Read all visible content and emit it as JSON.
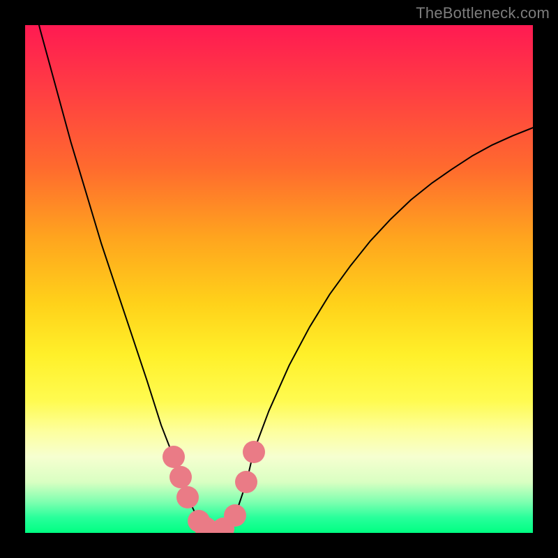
{
  "watermark": "TheBottleneck.com",
  "chart_data": {
    "type": "line",
    "title": "",
    "xlabel": "",
    "ylabel": "",
    "xlim": [
      0,
      1
    ],
    "ylim": [
      0,
      1
    ],
    "legend": false,
    "grid": false,
    "note": "Axes are unlabeled; coordinates are normalized fractions of the plot area (0,0)=top-left, (1,1)=bottom-right. Curve is a V-shaped bottleneck sweep with minimum near x≈0.37.",
    "series": [
      {
        "name": "bottleneck-curve",
        "x": [
          0.0,
          0.03,
          0.06,
          0.09,
          0.12,
          0.15,
          0.18,
          0.21,
          0.24,
          0.268,
          0.292,
          0.306,
          0.32,
          0.342,
          0.356,
          0.37,
          0.39,
          0.414,
          0.436,
          0.45,
          0.48,
          0.52,
          0.56,
          0.6,
          0.64,
          0.68,
          0.72,
          0.76,
          0.8,
          0.84,
          0.88,
          0.92,
          0.96,
          1.0
        ],
        "y": [
          -0.11,
          0.01,
          0.12,
          0.23,
          0.33,
          0.43,
          0.52,
          0.61,
          0.7,
          0.788,
          0.85,
          0.89,
          0.93,
          0.976,
          0.99,
          0.998,
          0.992,
          0.965,
          0.9,
          0.84,
          0.76,
          0.67,
          0.595,
          0.53,
          0.475,
          0.425,
          0.382,
          0.344,
          0.312,
          0.284,
          0.258,
          0.236,
          0.218,
          0.202
        ]
      }
    ],
    "markers": {
      "name": "highlight-dots",
      "color": "#ea7b86",
      "radius_px": 16,
      "points": [
        {
          "x": 0.292,
          "y": 0.85
        },
        {
          "x": 0.306,
          "y": 0.89
        },
        {
          "x": 0.32,
          "y": 0.93
        },
        {
          "x": 0.342,
          "y": 0.976
        },
        {
          "x": 0.356,
          "y": 0.99
        },
        {
          "x": 0.37,
          "y": 0.998
        },
        {
          "x": 0.39,
          "y": 0.992
        },
        {
          "x": 0.414,
          "y": 0.965
        },
        {
          "x": 0.436,
          "y": 0.9
        },
        {
          "x": 0.45,
          "y": 0.84
        }
      ]
    },
    "background_gradient": {
      "direction": "top-to-bottom",
      "stops": [
        {
          "offset": 0.0,
          "color": "#ff1a52"
        },
        {
          "offset": 0.28,
          "color": "#ff6a2e"
        },
        {
          "offset": 0.55,
          "color": "#ffd21a"
        },
        {
          "offset": 0.8,
          "color": "#fdff9e"
        },
        {
          "offset": 1.0,
          "color": "#00ff82"
        }
      ]
    }
  }
}
